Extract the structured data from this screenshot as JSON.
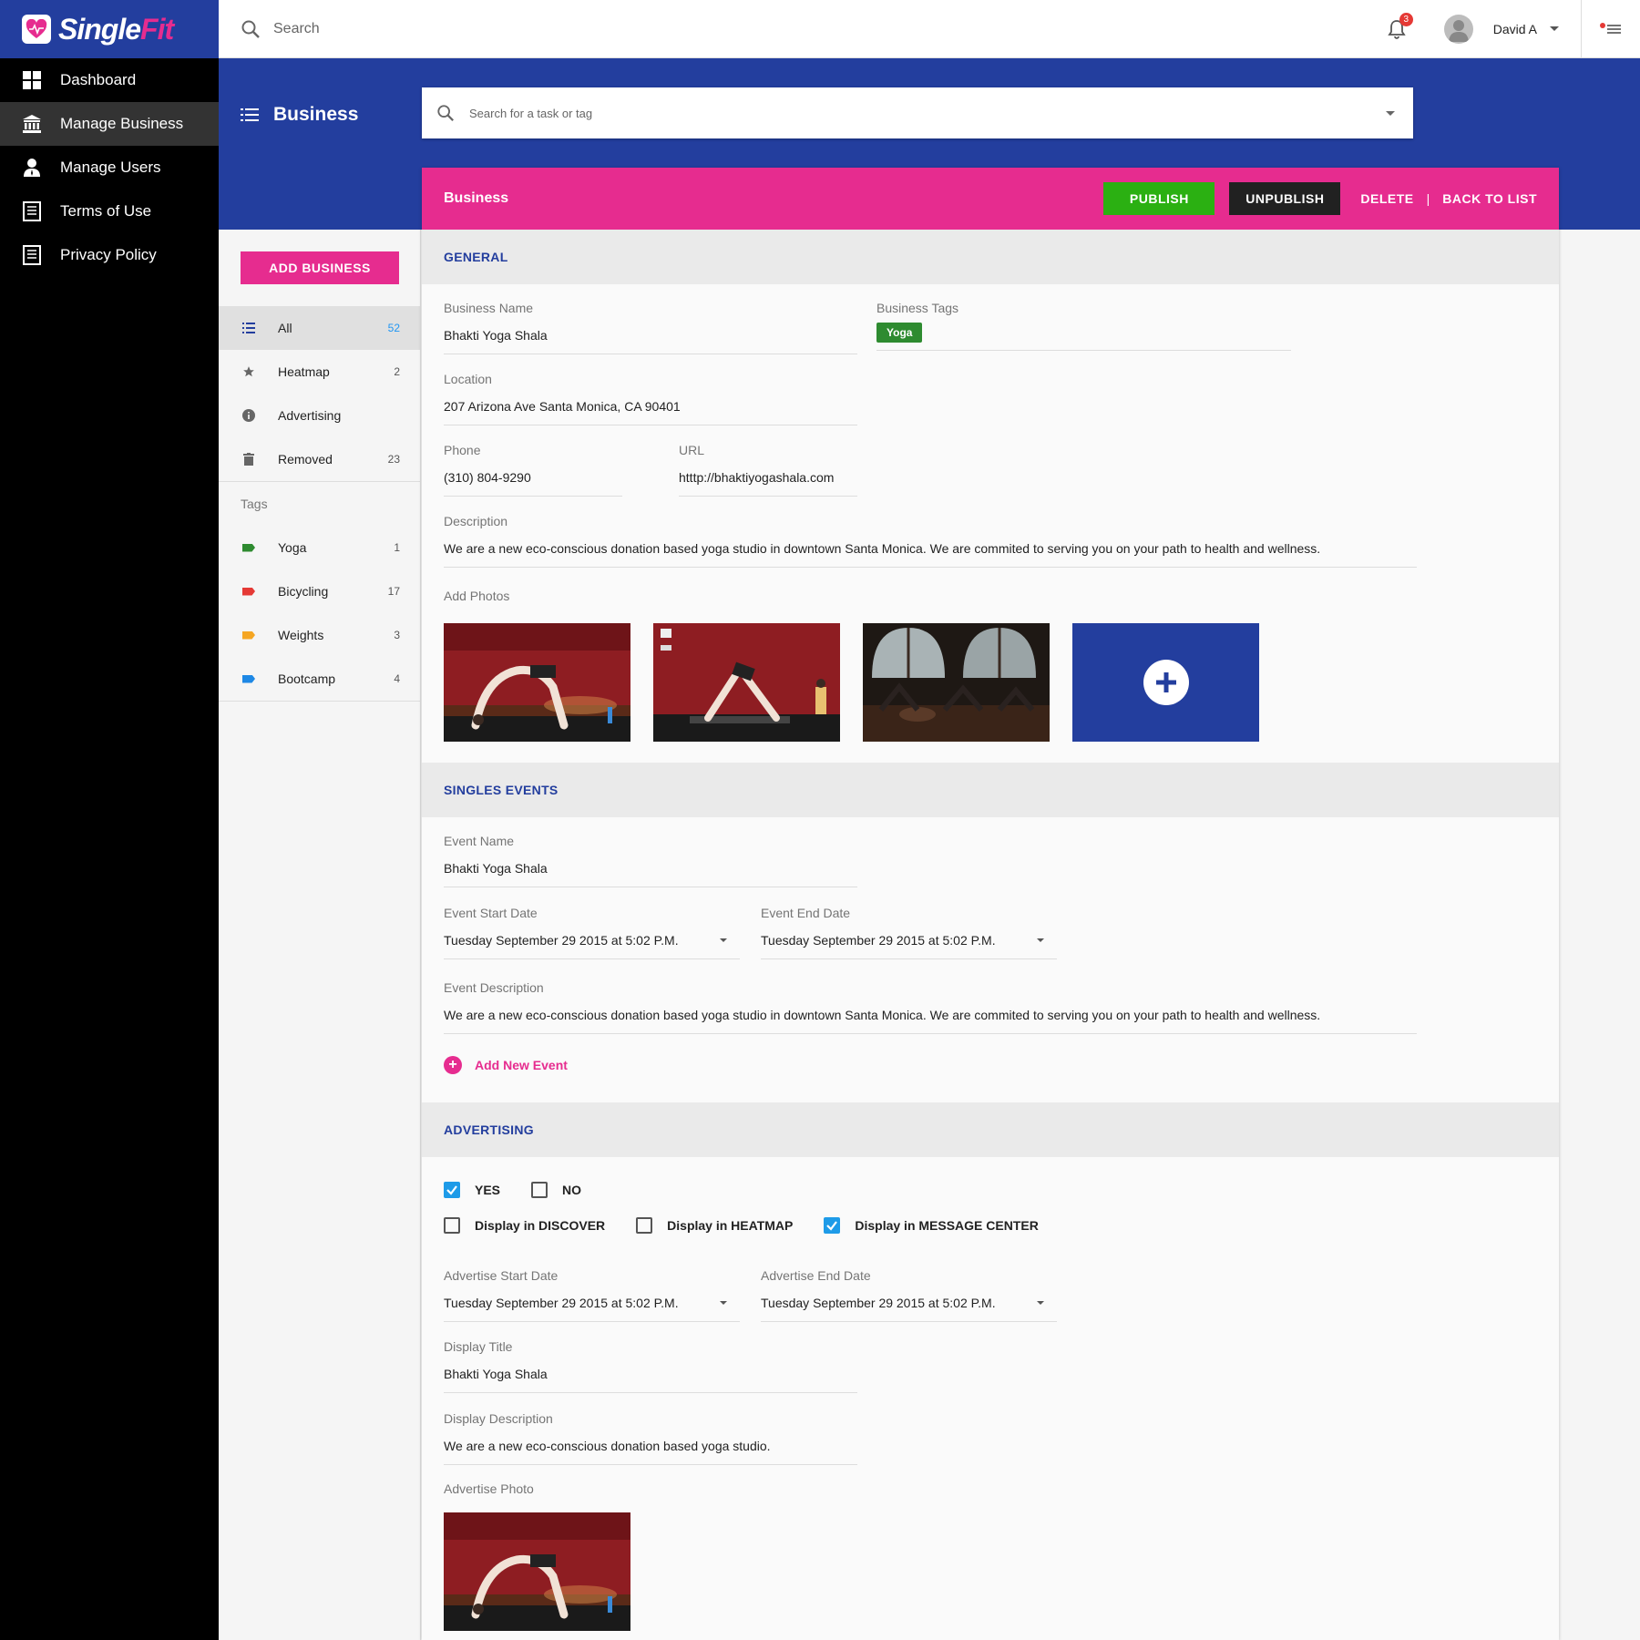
{
  "app": {
    "logo_main": "Single",
    "logo_accent": "Fit",
    "brand_blue": "#233e9e",
    "brand_pink": "#e62c8f"
  },
  "nav": [
    {
      "label": "Dashboard",
      "icon": "dashboard-icon"
    },
    {
      "label": "Manage Business",
      "icon": "bank-icon",
      "active": true
    },
    {
      "label": "Manage Users",
      "icon": "user-icon"
    },
    {
      "label": "Terms of Use",
      "icon": "document-icon"
    },
    {
      "label": "Privacy Policy",
      "icon": "document-icon"
    }
  ],
  "topbar": {
    "search_placeholder": "Search",
    "notifications": "3",
    "user_name": "David A"
  },
  "header": {
    "title": "Business",
    "task_search_placeholder": "Search for a task or tag"
  },
  "sidebar": {
    "add_button": "ADD BUSINESS",
    "filters": [
      {
        "label": "All",
        "count": "52",
        "icon": "list-icon",
        "active": true
      },
      {
        "label": "Heatmap",
        "count": "2",
        "icon": "star-icon"
      },
      {
        "label": "Advertising",
        "count": "",
        "icon": "info-icon"
      },
      {
        "label": "Removed",
        "count": "23",
        "icon": "trash-icon"
      }
    ],
    "tags_label": "Tags",
    "tags": [
      {
        "label": "Yoga",
        "count": "1",
        "color": "#2e8b30"
      },
      {
        "label": "Bicycling",
        "count": "17",
        "color": "#e53935"
      },
      {
        "label": "Weights",
        "count": "3",
        "color": "#f5a623"
      },
      {
        "label": "Bootcamp",
        "count": "4",
        "color": "#1e88e5"
      }
    ]
  },
  "card": {
    "title": "Business",
    "publish": "PUBLISH",
    "unpublish": "UNPUBLISH",
    "delete": "DELETE",
    "separator": "|",
    "back": "BACK TO LIST"
  },
  "general": {
    "heading": "GENERAL",
    "business_name_label": "Business Name",
    "business_name": "Bhakti Yoga Shala",
    "business_tags_label": "Business Tags",
    "business_tag": "Yoga",
    "location_label": "Location",
    "location": "207 Arizona Ave Santa Monica, CA 90401",
    "phone_label": "Phone",
    "phone": "(310) 804-9290",
    "url_label": "URL",
    "url": "htttp://bhaktiyogashala.com",
    "description_label": "Description",
    "description": "We are a new eco-conscious donation based yoga studio in downtown Santa Monica. We are commited to serving you on your path to health and wellness.",
    "photos_label": "Add Photos"
  },
  "events": {
    "heading": "SINGLES EVENTS",
    "name_label": "Event Name",
    "name": "Bhakti Yoga Shala",
    "start_label": "Event Start Date",
    "start": "Tuesday September 29 2015 at 5:02 P.M.",
    "end_label": "Event End Date",
    "end": "Tuesday September 29 2015 at 5:02 P.M.",
    "description_label": "Event Description",
    "description": "We are a new eco-conscious donation based yoga studio in downtown Santa Monica. We are commited to serving you on your path to health and wellness.",
    "add_new": "Add New Event"
  },
  "advertising": {
    "heading": "ADVERTISING",
    "yes": "YES",
    "no": "NO",
    "yes_checked": true,
    "no_checked": false,
    "discover": "Display in DISCOVER",
    "heatmap": "Display in HEATMAP",
    "message_center": "Display in MESSAGE CENTER",
    "discover_checked": false,
    "heatmap_checked": false,
    "message_center_checked": true,
    "start_label": "Advertise Start Date",
    "start": "Tuesday September 29 2015 at 5:02 P.M.",
    "end_label": "Advertise End Date",
    "end": "Tuesday September 29 2015 at 5:02 P.M.",
    "title_label": "Display Title",
    "title": "Bhakti Yoga Shala",
    "description_label": "Display Description",
    "description": "We are a new eco-conscious donation based yoga studio.",
    "photo_label": "Advertise Photo"
  }
}
